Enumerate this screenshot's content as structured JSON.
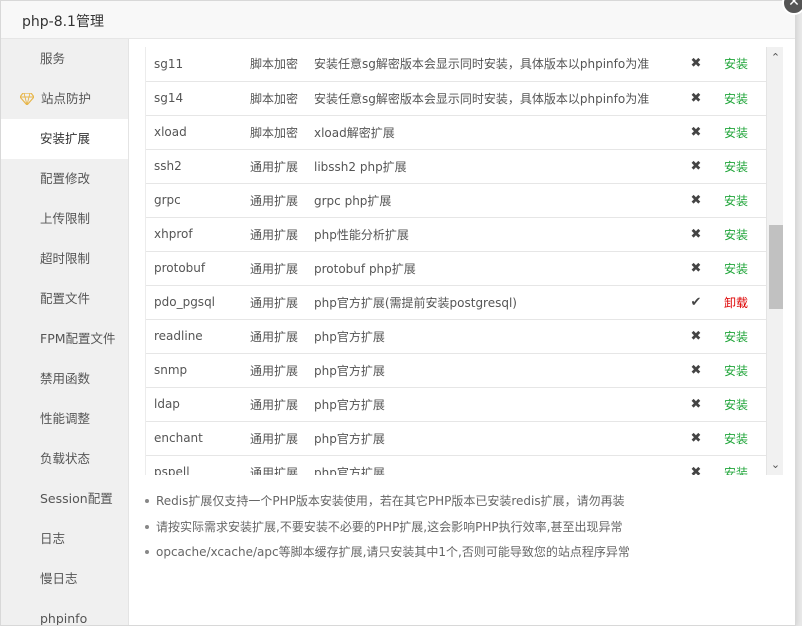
{
  "window": {
    "title": "php-8.1管理",
    "close_glyph": "✕"
  },
  "sidebar": {
    "items": [
      {
        "label": "服务"
      },
      {
        "label": "站点防护",
        "icon": "gem-icon",
        "icon_color": "#e7b64b"
      },
      {
        "label": "安装扩展",
        "active": true
      },
      {
        "label": "配置修改"
      },
      {
        "label": "上传限制"
      },
      {
        "label": "超时限制"
      },
      {
        "label": "配置文件"
      },
      {
        "label": "FPM配置文件"
      },
      {
        "label": "禁用函数"
      },
      {
        "label": "性能调整"
      },
      {
        "label": "负载状态"
      },
      {
        "label": "Session配置"
      },
      {
        "label": "日志"
      },
      {
        "label": "慢日志"
      },
      {
        "label": "phpinfo"
      }
    ]
  },
  "extensions": {
    "rows": [
      {
        "name": "sg11",
        "type": "脚本加密",
        "desc": "安装任意sg解密版本会显示同时安装，具体版本以phpinfo为准",
        "status": "✖",
        "action": "安装",
        "installed": false
      },
      {
        "name": "sg14",
        "type": "脚本加密",
        "desc": "安装任意sg解密版本会显示同时安装，具体版本以phpinfo为准",
        "status": "✖",
        "action": "安装",
        "installed": false
      },
      {
        "name": "xload",
        "type": "脚本加密",
        "desc": "xload解密扩展",
        "status": "✖",
        "action": "安装",
        "installed": false
      },
      {
        "name": "ssh2",
        "type": "通用扩展",
        "desc": "libssh2 php扩展",
        "status": "✖",
        "action": "安装",
        "installed": false
      },
      {
        "name": "grpc",
        "type": "通用扩展",
        "desc": "grpc php扩展",
        "status": "✖",
        "action": "安装",
        "installed": false
      },
      {
        "name": "xhprof",
        "type": "通用扩展",
        "desc": "php性能分析扩展",
        "status": "✖",
        "action": "安装",
        "installed": false
      },
      {
        "name": "protobuf",
        "type": "通用扩展",
        "desc": "protobuf php扩展",
        "status": "✖",
        "action": "安装",
        "installed": false
      },
      {
        "name": "pdo_pgsql",
        "type": "通用扩展",
        "desc": "php官方扩展(需提前安装postgresql)",
        "status": "✔",
        "action": "卸载",
        "installed": true
      },
      {
        "name": "readline",
        "type": "通用扩展",
        "desc": "php官方扩展",
        "status": "✖",
        "action": "安装",
        "installed": false
      },
      {
        "name": "snmp",
        "type": "通用扩展",
        "desc": "php官方扩展",
        "status": "✖",
        "action": "安装",
        "installed": false
      },
      {
        "name": "ldap",
        "type": "通用扩展",
        "desc": "php官方扩展",
        "status": "✖",
        "action": "安装",
        "installed": false
      },
      {
        "name": "enchant",
        "type": "通用扩展",
        "desc": "php官方扩展",
        "status": "✖",
        "action": "安装",
        "installed": false
      },
      {
        "name": "pspell",
        "type": "通用扩展",
        "desc": "php官方扩展",
        "status": "✖",
        "action": "安装",
        "installed": false
      }
    ]
  },
  "scrollbar": {
    "up_glyph": "⌃",
    "down_glyph": "⌄",
    "position_fraction": 0.52
  },
  "notes": [
    "Redis扩展仅支持一个PHP版本安装使用，若在其它PHP版本已安装redis扩展，请勿再装",
    "请按实际需求安装扩展,不要安装不必要的PHP扩展,这会影响PHP执行效率,甚至出现异常",
    "opcache/xcache/apc等脚本缓存扩展,请只安装其中1个,否则可能导致您的站点程序异常"
  ],
  "colors": {
    "install": "#20a53a",
    "uninstall": "#dd0000",
    "active_bg": "#ffffff",
    "sidebar_bg": "#f0f0f0"
  }
}
